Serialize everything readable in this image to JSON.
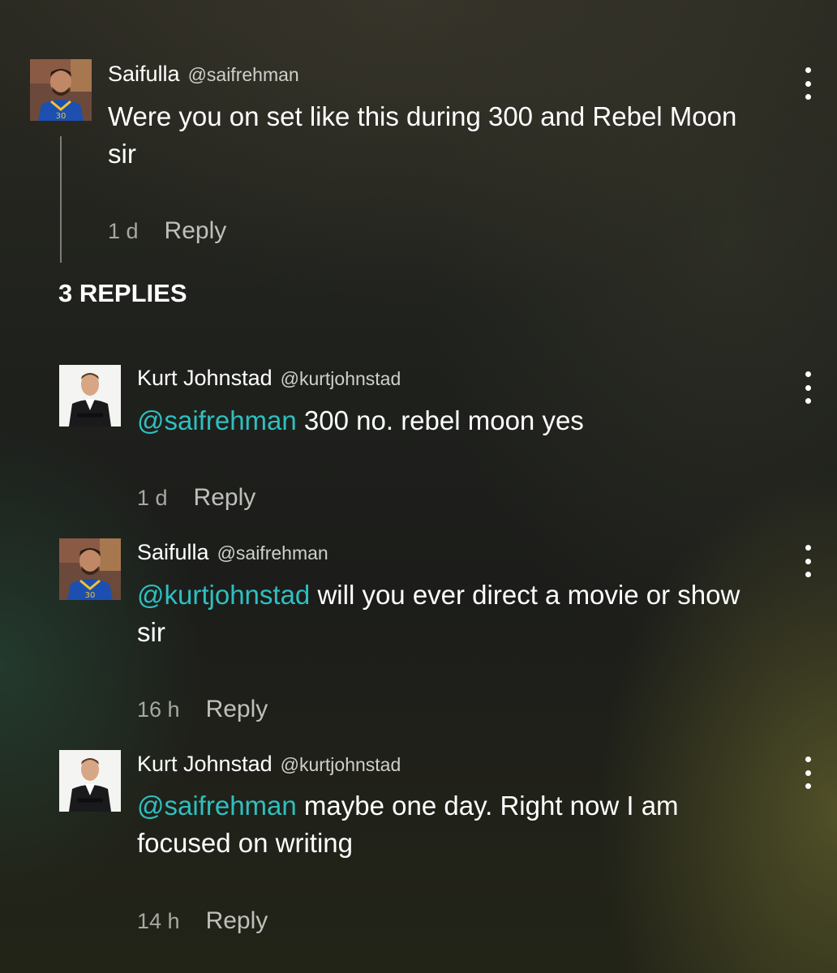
{
  "parent_comment": {
    "name": "Saifulla",
    "handle": "@saifrehman",
    "text": "Were you on set like this during 300 and Rebel Moon sir",
    "time": "1 d",
    "reply_label": "Reply",
    "avatar_icon": "basketball-player-avatar"
  },
  "replies_header": "3 REPLIES",
  "replies": [
    {
      "name": "Kurt Johnstad",
      "handle": "@kurtjohnstad",
      "mention": "@saifrehman",
      "text": " 300 no. rebel moon yes",
      "time": "1 d",
      "reply_label": "Reply",
      "avatar_icon": "man-in-suit-avatar"
    },
    {
      "name": "Saifulla",
      "handle": "@saifrehman",
      "mention": "@kurtjohnstad",
      "text": " will you ever direct a movie or show sir",
      "time": "16 h",
      "reply_label": "Reply",
      "avatar_icon": "basketball-player-avatar"
    },
    {
      "name": "Kurt Johnstad",
      "handle": "@kurtjohnstad",
      "mention": "@saifrehman",
      "text": " maybe one day. Right now I am focused on writing",
      "time": "14 h",
      "reply_label": "Reply",
      "avatar_icon": "man-in-suit-avatar"
    }
  ],
  "colors": {
    "mention": "#2fbfc0",
    "text": "#ffffff",
    "muted": "#a7a8a3"
  }
}
